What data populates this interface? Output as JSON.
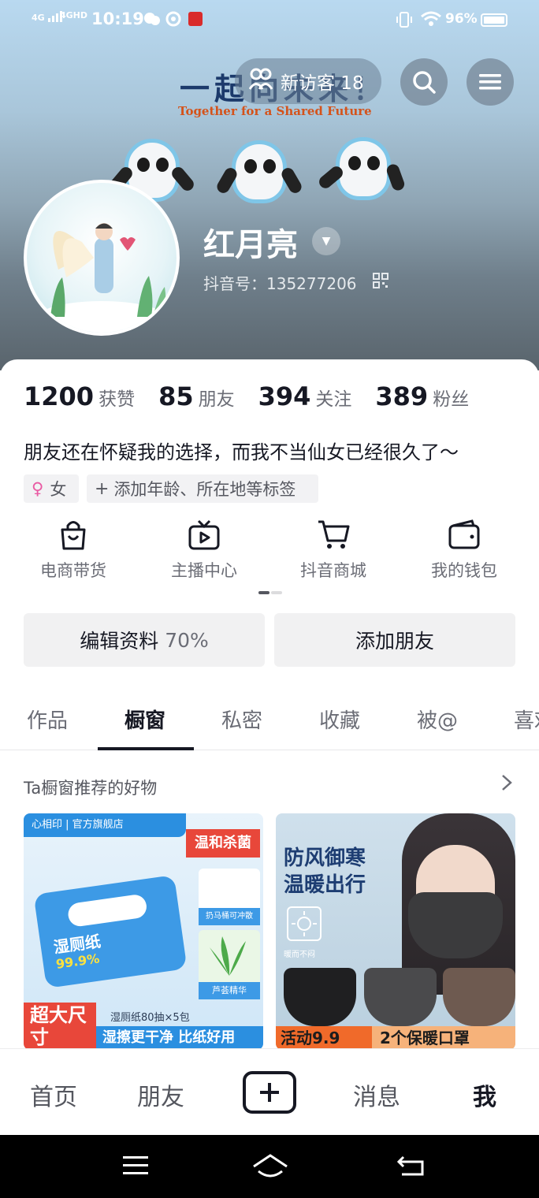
{
  "status_bar": {
    "signal_1": "4G",
    "signal_2": "4GHD",
    "time": "10:19",
    "battery": "96%"
  },
  "banner": {
    "art_title": "一起向未来！",
    "art_subtitle": "Together for a Shared Future"
  },
  "header": {
    "visitor_label": "新访客 18"
  },
  "profile": {
    "name": "红月亮",
    "douyin_id": "抖音号：135277206"
  },
  "stats": [
    {
      "value": "1200",
      "label": "获赞"
    },
    {
      "value": "85",
      "label": "朋友"
    },
    {
      "value": "394",
      "label": "关注"
    },
    {
      "value": "389",
      "label": "粉丝"
    }
  ],
  "bio": "朋友还在怀疑我的选择，而我不当仙女已经很久了～",
  "tags": {
    "gender": "女",
    "add_tags": "添加年龄、所在地等标签"
  },
  "quick_entries": [
    {
      "label": "电商带货",
      "icon": "shopping-bag-icon"
    },
    {
      "label": "主播中心",
      "icon": "tv-play-icon"
    },
    {
      "label": "抖音商城",
      "icon": "cart-icon"
    },
    {
      "label": "我的钱包",
      "icon": "wallet-icon"
    }
  ],
  "buttons": {
    "edit_profile": "编辑资料",
    "edit_percent": "70%",
    "add_friend": "添加朋友"
  },
  "tabs": [
    "作品",
    "橱窗",
    "私密",
    "收藏",
    "被@",
    "喜欢"
  ],
  "active_tab": "橱窗",
  "showcase": {
    "title": "Ta橱窗推荐的好物",
    "products": [
      {
        "brand": "心相印 | 官方旗舰店",
        "badge": "温和杀菌",
        "pack": "湿厕纸",
        "pack_pct": "99.9%",
        "feature_1": "扔马桶可冲散",
        "feature_2": "芦荟精华",
        "spec": "湿厕纸80抽×5包",
        "banner_left": "超大尺寸",
        "banner_right": "湿擦更干净 比纸好用"
      },
      {
        "headline_1": "防风御寒",
        "headline_2": "温暖出行",
        "small": "暖而不闷",
        "banner_left": "活动9.9",
        "banner_right": "2个保暖口罩"
      }
    ]
  },
  "bottom_nav": [
    "首页",
    "朋友",
    "消息",
    "我"
  ],
  "colors": {
    "text_primary": "#161823",
    "text_secondary": "#6b6d76",
    "button_bg": "#f1f1f2"
  }
}
